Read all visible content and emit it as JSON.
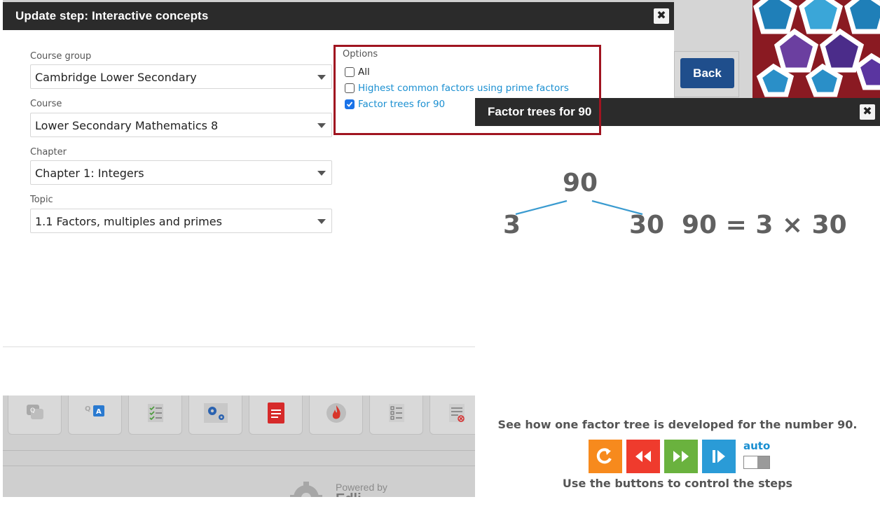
{
  "background": {
    "back_button_label": "Back",
    "powered_by_label": "Powered by",
    "powered_by_brand": "Edli",
    "toolbar_icons": [
      "chat-bubbles-icon",
      "q-and-a-icon",
      "checklist-icon",
      "settings-gears-icon",
      "document-icon",
      "flame-icon",
      "checklist-boxes-icon",
      "document-remove-icon"
    ]
  },
  "dialog": {
    "title": "Update step: Interactive concepts",
    "close_symbol": "✖",
    "fields": {
      "course_group": {
        "label": "Course group",
        "value": "Cambridge Lower Secondary"
      },
      "course": {
        "label": "Course",
        "value": "Lower Secondary Mathematics 8"
      },
      "chapter": {
        "label": "Chapter",
        "value": "Chapter 1: Integers"
      },
      "topic": {
        "label": "Topic",
        "value": "1.1 Factors, multiples and primes"
      }
    },
    "options": {
      "label": "Options",
      "items": [
        {
          "label": "All",
          "checked": false
        },
        {
          "label": "Highest common factors using prime factors",
          "checked": false
        },
        {
          "label": "Factor trees for 90",
          "checked": true
        }
      ]
    }
  },
  "popup": {
    "title": "Factor trees for 90",
    "close_symbol": "✖",
    "tree": {
      "root": "90",
      "left": "3",
      "right": "30",
      "equation": "90 = 3 × 30"
    },
    "description": "See how one factor tree is developed for the number 90.",
    "controls": [
      {
        "name": "restart",
        "color": "#f78a1d"
      },
      {
        "name": "step-back",
        "color": "#ef3b2d"
      },
      {
        "name": "step-forward",
        "color": "#6ab23e"
      },
      {
        "name": "play-to-end",
        "color": "#2a9bd7"
      }
    ],
    "auto_label": "auto",
    "auto_enabled": false,
    "instruction": "Use the buttons to control the steps"
  },
  "colors": {
    "header_bg": "#2b2b2b",
    "link_blue": "#1a8fd1",
    "highlight_red": "#a01420",
    "back_button": "#1f4e8c"
  }
}
